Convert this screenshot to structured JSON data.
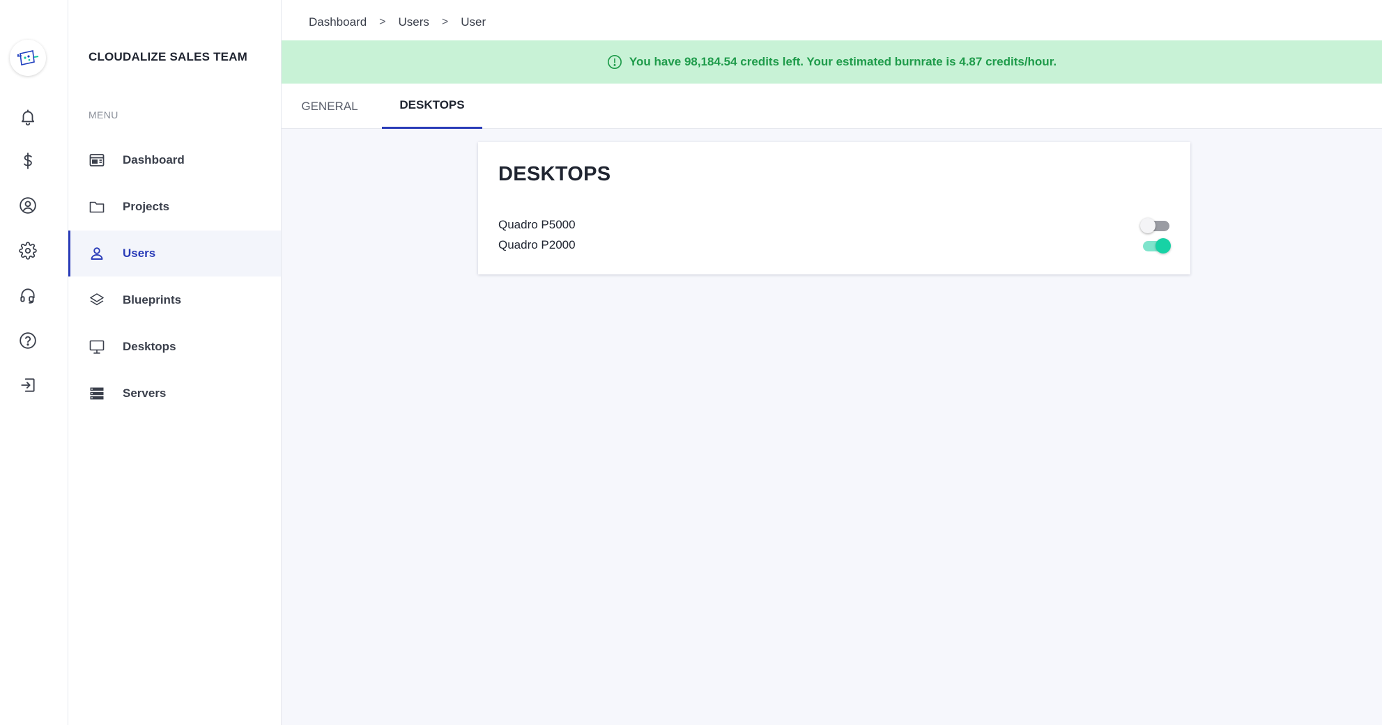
{
  "rail": {
    "logo_icon": "cloudalize-logo-icon",
    "icons": [
      "bell-icon",
      "dollar-icon",
      "user-circle-icon",
      "gear-icon",
      "headset-icon",
      "help-circle-icon",
      "logout-icon"
    ]
  },
  "sidebar": {
    "org_name": "CLOUDALIZE SALES TEAM",
    "menu_label": "MENU",
    "items": [
      {
        "label": "Dashboard",
        "icon": "dashboard-icon",
        "active": false
      },
      {
        "label": "Projects",
        "icon": "folder-icon",
        "active": false
      },
      {
        "label": "Users",
        "icon": "user-icon",
        "active": true
      },
      {
        "label": "Blueprints",
        "icon": "layers-icon",
        "active": false
      },
      {
        "label": "Desktops",
        "icon": "monitor-icon",
        "active": false
      },
      {
        "label": "Servers",
        "icon": "server-icon",
        "active": false
      }
    ]
  },
  "breadcrumb": {
    "items": [
      "Dashboard",
      "Users",
      "User"
    ],
    "separator": ">"
  },
  "banner": {
    "text": "You have 98,184.54 credits left. Your estimated burnrate is 4.87 credits/hour.",
    "icon": "info-circle-icon"
  },
  "tabs": [
    {
      "label": "GENERAL",
      "active": false
    },
    {
      "label": "DESKTOPS",
      "active": true
    }
  ],
  "desktops_card": {
    "title": "DESKTOPS",
    "items": [
      {
        "name": "Quadro P5000",
        "enabled": false
      },
      {
        "name": "Quadro P2000",
        "enabled": true
      }
    ]
  },
  "colors": {
    "accent": "#2a3cb8",
    "banner_bg": "#c8f2d6",
    "banner_text": "#1e9b4a",
    "toggle_on": "#17d2a5",
    "main_bg": "#f6f7fc"
  }
}
